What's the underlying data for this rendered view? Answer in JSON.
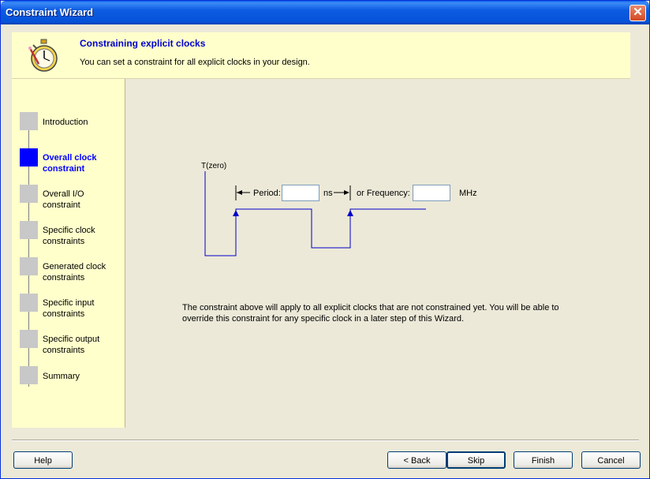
{
  "window": {
    "title": "Constraint Wizard"
  },
  "header": {
    "title": "Constraining explicit clocks",
    "subtitle": "You can set a constraint for all explicit clocks in your design."
  },
  "steps": [
    {
      "label": "Introduction",
      "active": false
    },
    {
      "label": "Overall clock constraint",
      "active": true
    },
    {
      "label": "Overall I/O constraint",
      "active": false
    },
    {
      "label": "Specific clock constraints",
      "active": false
    },
    {
      "label": "Generated clock constraints",
      "active": false
    },
    {
      "label": "Specific input constraints",
      "active": false
    },
    {
      "label": "Specific output constraints",
      "active": false
    },
    {
      "label": "Summary",
      "active": false
    }
  ],
  "diagram": {
    "t_zero": "T(zero)",
    "period_label": "Period:",
    "period_value": "",
    "period_unit": "ns",
    "frequency_label": "or Frequency:",
    "frequency_value": "",
    "frequency_unit": "MHz"
  },
  "description": "The constraint above will apply to all explicit clocks that are not constrained yet. You will be able to override this constraint for any specific clock in a later step of this Wizard.",
  "buttons": {
    "help": "Help",
    "back": "< Back",
    "skip": "Skip",
    "finish": "Finish",
    "cancel": "Cancel"
  },
  "colors": {
    "accent": "#0000CC",
    "active_step": "#0000FF",
    "inactive_step": "#C8C8C8",
    "panel_bg": "#FFFFCC",
    "waveform": "#0000CC"
  }
}
